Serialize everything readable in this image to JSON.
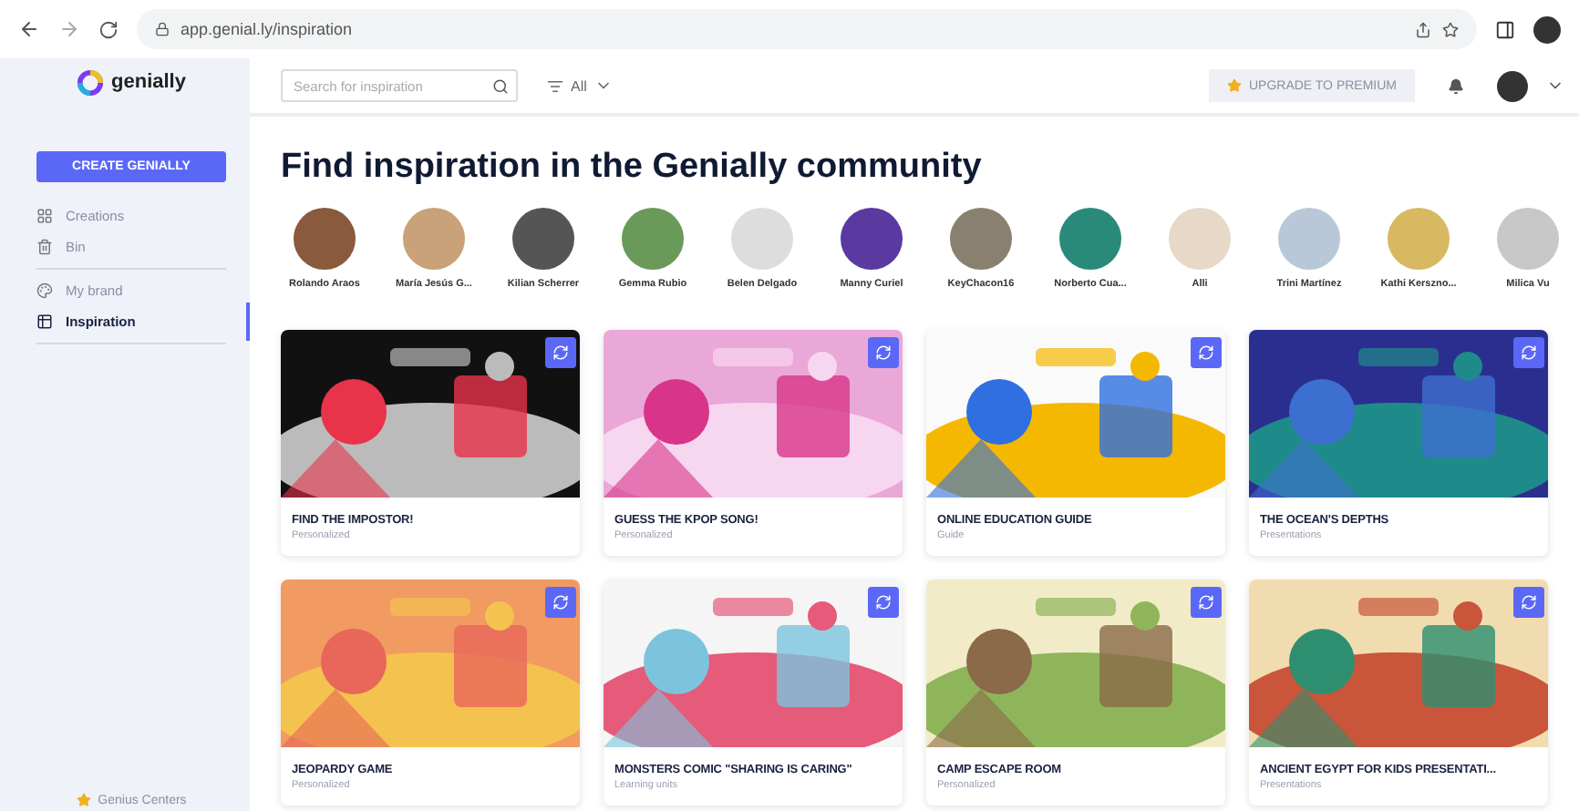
{
  "browser": {
    "url": "app.genial.ly/inspiration"
  },
  "sidebar": {
    "logo": "genially",
    "create_button": "CREATE GENIALLY",
    "items": [
      {
        "label": "Creations",
        "selected": false,
        "divider_after": false
      },
      {
        "label": "Bin",
        "selected": false,
        "divider_after": true
      },
      {
        "label": "My brand",
        "selected": false,
        "divider_after": false
      },
      {
        "label": "Inspiration",
        "selected": true,
        "divider_after": true
      }
    ],
    "footer": "Genius Centers"
  },
  "header": {
    "search": {
      "placeholder": "Search for inspiration"
    },
    "filter": "All",
    "upgrade_button": "UPGRADE TO PREMIUM"
  },
  "title": "Find inspiration in the Genially community",
  "creators": [
    {
      "name": "Rolando Araos"
    },
    {
      "name": "María Jesús G..."
    },
    {
      "name": "Kilian Scherrer"
    },
    {
      "name": "Gemma Rubio"
    },
    {
      "name": "Belen Delgado"
    },
    {
      "name": "Manny Curiel"
    },
    {
      "name": "KeyChacon16"
    },
    {
      "name": "Norberto Cua..."
    },
    {
      "name": "Alli"
    },
    {
      "name": "Trini Martínez"
    },
    {
      "name": "Kathi Kerszno..."
    },
    {
      "name": "Milica Vu"
    }
  ],
  "cards": [
    {
      "title": "FIND THE IMPOSTOR!",
      "category": "Personalized"
    },
    {
      "title": "GUESS THE KPOP SONG!",
      "category": "Personalized"
    },
    {
      "title": "ONLINE EDUCATION GUIDE",
      "category": "Guide"
    },
    {
      "title": "THE OCEAN'S DEPTHS",
      "category": "Presentations"
    },
    {
      "title": "JEOPARDY GAME",
      "category": "Personalized"
    },
    {
      "title": "MONSTERS COMIC \"SHARING IS CARING\"",
      "category": "Learning units"
    },
    {
      "title": "CAMP ESCAPE ROOM",
      "category": "Personalized"
    },
    {
      "title": "ANCIENT EGYPT FOR KIDS PRESENTATI...",
      "category": "Presentations"
    }
  ]
}
